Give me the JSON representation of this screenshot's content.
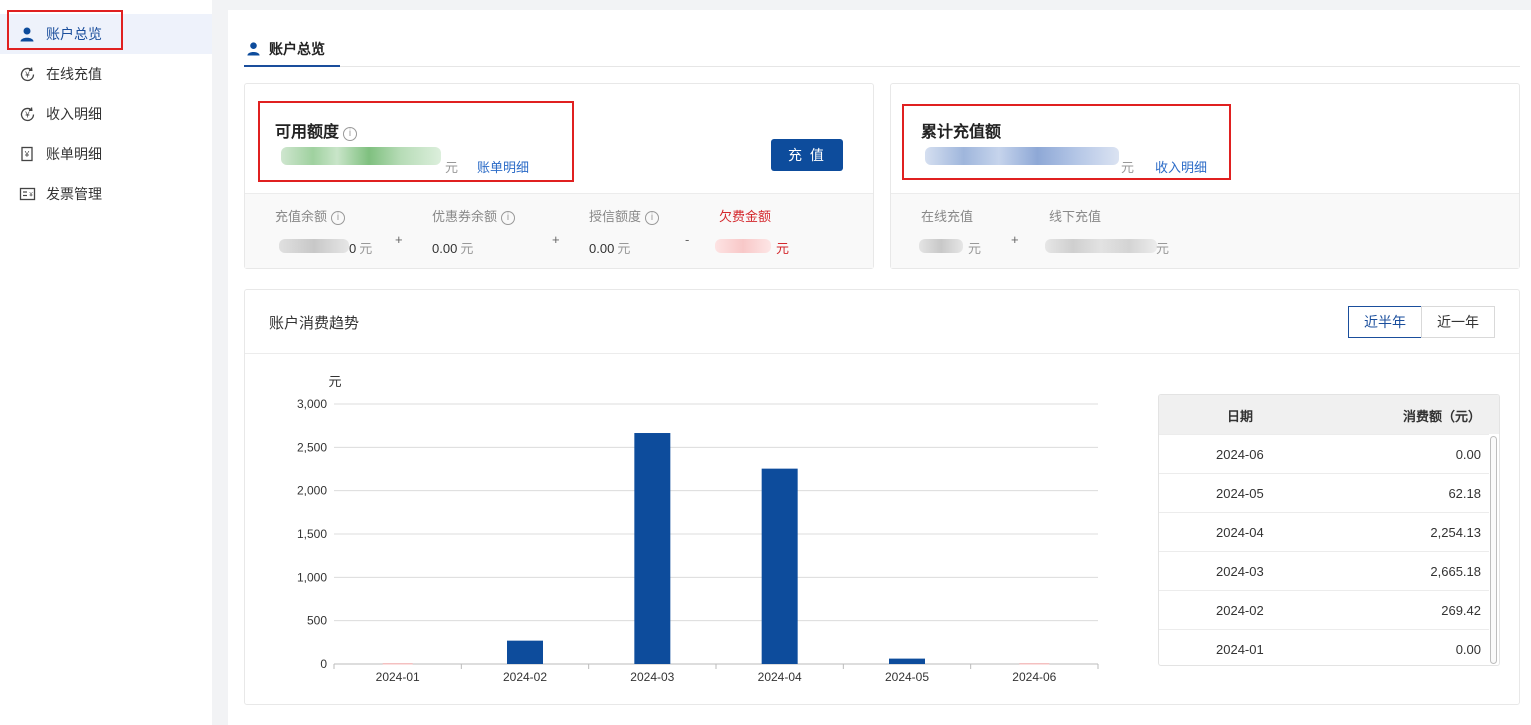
{
  "sidebar": {
    "items": [
      {
        "label": "账户总览",
        "icon": "user-icon",
        "active": true
      },
      {
        "label": "在线充值",
        "icon": "yen-refresh-icon",
        "active": false
      },
      {
        "label": "收入明细",
        "icon": "yen-refresh-icon",
        "active": false
      },
      {
        "label": "账单明细",
        "icon": "bill-icon",
        "active": false
      },
      {
        "label": "发票管理",
        "icon": "invoice-icon",
        "active": false
      }
    ]
  },
  "header": {
    "tab_label": "账户总览"
  },
  "available": {
    "title": "可用额度",
    "unit": "元",
    "link": "账单明细",
    "button": "充 值",
    "breakdown": {
      "balance_label": "充值余额",
      "balance_value_suffix": "0",
      "coupon_label": "优惠券余额",
      "coupon_value": "0.00",
      "credit_label": "授信额度",
      "credit_value": "0.00",
      "arrears_label": "欠费金额",
      "unit": "元",
      "op_plus": "+",
      "op_minus": "-"
    }
  },
  "total_recharge": {
    "title": "累计充值额",
    "unit": "元",
    "link": "收入明细",
    "breakdown": {
      "online_label": "在线充值",
      "offline_label": "线下充值",
      "unit": "元",
      "op_plus": "+"
    }
  },
  "trend": {
    "title": "账户消费趋势",
    "range_options": [
      "近半年",
      "近一年"
    ],
    "selected_range": "近半年"
  },
  "chart_data": {
    "type": "bar",
    "title": "",
    "ylabel": "元",
    "xlabel": "",
    "categories": [
      "2024-01",
      "2024-02",
      "2024-03",
      "2024-04",
      "2024-05",
      "2024-06"
    ],
    "values": [
      0.0,
      269.42,
      2665.18,
      2254.13,
      62.18,
      0.0
    ],
    "ylim": [
      0,
      3000
    ],
    "yticks": [
      "0",
      "500",
      "1,000",
      "1,500",
      "2,000",
      "2,500",
      "3,000"
    ],
    "bar_color": "#0d4c9c",
    "grid": true
  },
  "table": {
    "headers": {
      "date": "日期",
      "amount": "消费额（元）"
    },
    "rows": [
      {
        "date": "2024-06",
        "amount": "0.00"
      },
      {
        "date": "2024-05",
        "amount": "62.18"
      },
      {
        "date": "2024-04",
        "amount": "2,254.13"
      },
      {
        "date": "2024-03",
        "amount": "2,665.18"
      },
      {
        "date": "2024-02",
        "amount": "269.42"
      },
      {
        "date": "2024-01",
        "amount": "0.00"
      }
    ]
  },
  "colors": {
    "accent": "#0d4c9c",
    "highlight": "#e02020",
    "warning": "#d4282d"
  }
}
